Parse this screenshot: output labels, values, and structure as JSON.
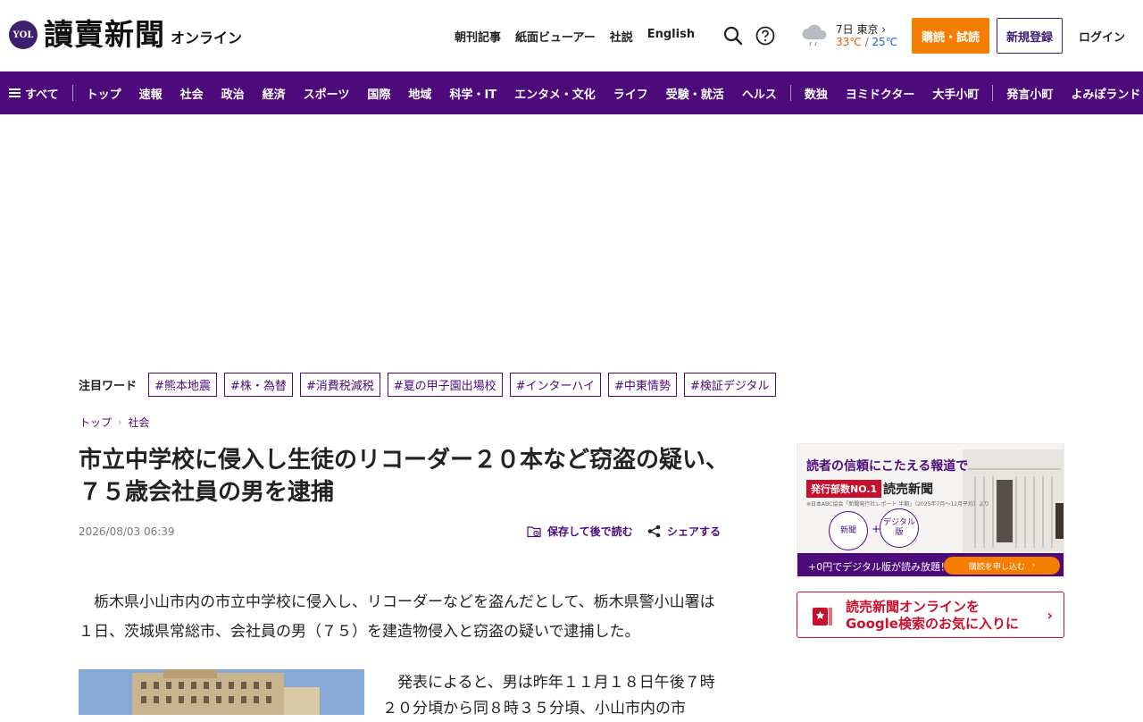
{
  "header": {
    "logo_badge": "YOL",
    "logo_name": "讀賣新聞",
    "logo_sub": "オンライン",
    "links": [
      "朝刊記事",
      "紙面ビューアー",
      "社説",
      "English"
    ],
    "weather": {
      "date_city": "7日 東京",
      "high": "33℃",
      "sep": " / ",
      "low": "25℃"
    },
    "subscribe_label": "購読・試読",
    "register_label": "新規登録",
    "login_label": "ログイン"
  },
  "nav": {
    "menu_label": "すべて",
    "group1": [
      "トップ",
      "速報",
      "社会",
      "政治",
      "経済",
      "スポーツ",
      "国際",
      "地域",
      "科学・IT",
      "エンタメ・文化",
      "ライフ",
      "受験・就活",
      "ヘルス"
    ],
    "group2": [
      "数独",
      "ヨミドクター",
      "大手小町"
    ],
    "group3": [
      "発言小町",
      "よみぽランド"
    ]
  },
  "keywords": {
    "label": "注目ワード",
    "tags": [
      "#熊本地震",
      "#株・為替",
      "#消費税減税",
      "#夏の甲子園出場校",
      "#インターハイ",
      "#中東情勢",
      "#検証デジタル"
    ]
  },
  "breadcrumb": {
    "home": "トップ",
    "section": "社会"
  },
  "article": {
    "title": "市立中学校に侵入し生徒のリコーダー２０本など窃盗の疑い、７５歳会社員の男を逮捕",
    "date": "2026/08/03 06:39",
    "save_label": "保存して後で読む",
    "share_label": "シェアする",
    "lead": "　栃木県小山市内の市立中学校に侵入し、リコーダーなどを盗んだとして、栃木県警小山署は１日、茨城県常総市、会社員の男（７５）を建造物侵入と窃盗の疑いで逮捕した。",
    "body2": "　発表によると、男は昨年１１月１８日午後７時２０分頃から同８時３５分頃、小山市内の市"
  },
  "sidebar": {
    "ad": {
      "headline": "読者の信頼にこたえる報道で",
      "no1": "発行部数NO.1",
      "paper": "読売新聞",
      "note": "※日本ABC協会「新聞発行社レポート 半期」（2025年7月〜12月平均）より",
      "circle1": "新聞",
      "plus": "+",
      "circle2": "デジタル版",
      "bottom_text": "+0円でデジタル版が読み放題！",
      "button": "購読を申し込む"
    },
    "google": {
      "line1": "読売新聞オンラインを",
      "line2": "Google検索のお気に入りに"
    }
  },
  "colors": {
    "brand": "#4c0a7a",
    "accent": "#f57d00",
    "red": "#c8102e"
  }
}
